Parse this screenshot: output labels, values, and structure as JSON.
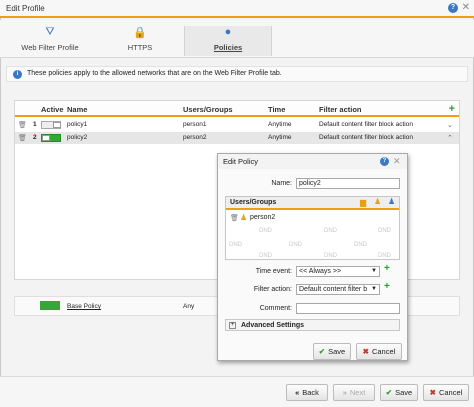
{
  "window": {
    "title": "Edit Profile"
  },
  "tabs": [
    {
      "label": "Web Filter Profile",
      "icon": "filter-icon"
    },
    {
      "label": "HTTPS",
      "icon": "lock-icon"
    },
    {
      "label": "Policies",
      "icon": "pin-icon"
    }
  ],
  "info": {
    "text": "These policies apply to the allowed networks that are on the Web Filter Profile tab."
  },
  "grid": {
    "columns": [
      "Active",
      "Name",
      "Users/Groups",
      "Time",
      "Filter action"
    ],
    "rows": [
      {
        "index": "1",
        "active": false,
        "name": "policy1",
        "users": "person1",
        "time": "Anytime",
        "action": "Default content filter block action"
      },
      {
        "index": "2",
        "active": true,
        "name": "policy2",
        "users": "person2",
        "time": "Anytime",
        "action": "Default content filter block action"
      }
    ]
  },
  "base_policy": {
    "label": "Base Policy",
    "users": "Any"
  },
  "footer": {
    "back": "Back",
    "next": "Next",
    "save": "Save",
    "cancel": "Cancel"
  },
  "modal": {
    "title": "Edit Policy",
    "name_label": "Name:",
    "name_value": "policy2",
    "users_groups_title": "Users/Groups",
    "member": "person2",
    "dnd": "DND",
    "time_label": "Time event:",
    "time_value": "<< Always >>",
    "filter_label": "Filter action:",
    "filter_value": "Default content filter b",
    "comment_label": "Comment:",
    "comment_value": "",
    "advanced": "Advanced Settings",
    "save": "Save",
    "cancel": "Cancel"
  },
  "colors": {
    "accent": "#f39c12",
    "active_green": "#3aa33a",
    "info_blue": "#3a78c3"
  }
}
